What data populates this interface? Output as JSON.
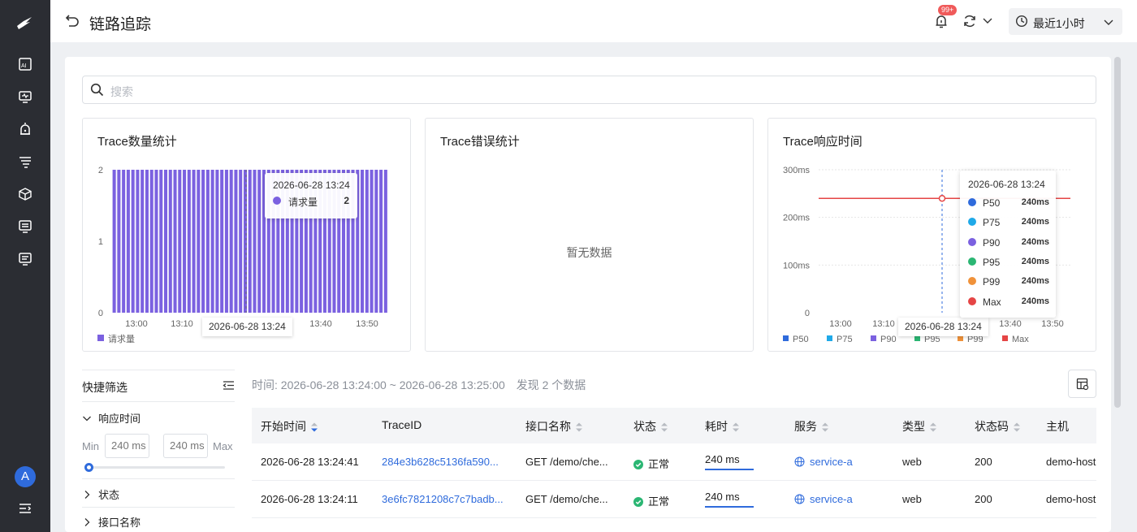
{
  "page": {
    "title": "链路追踪"
  },
  "header": {
    "badge": "99+",
    "time_range": "最近1小时"
  },
  "search": {
    "placeholder": "搜索"
  },
  "cards": {
    "count": {
      "title": "Trace数量统计",
      "legend": "请求量",
      "tooltip_time": "2026-06-28 13:24",
      "tooltip_label": "请求量",
      "tooltip_value": "2",
      "xtip": "2026-06-28 13:24"
    },
    "errors": {
      "title": "Trace错误统计",
      "empty": "暂无数据"
    },
    "latency": {
      "title": "Trace响应时间",
      "tooltip_time": "2026-06-28 13:24",
      "xtip": "2026-06-28 13:24",
      "tooltip_rows": [
        {
          "name": "P50",
          "value": "240ms",
          "color": "#2f6bdc"
        },
        {
          "name": "P75",
          "value": "240ms",
          "color": "#1fa9e8"
        },
        {
          "name": "P90",
          "value": "240ms",
          "color": "#7b61e0"
        },
        {
          "name": "P95",
          "value": "240ms",
          "color": "#2bb673"
        },
        {
          "name": "P99",
          "value": "240ms",
          "color": "#f0923a"
        },
        {
          "name": "Max",
          "value": "240ms",
          "color": "#e54545"
        }
      ]
    }
  },
  "chart_data": [
    {
      "type": "bar",
      "title": "Trace数量统计",
      "ylim": [
        0,
        2
      ],
      "yticks": [
        "0",
        "1",
        "2"
      ],
      "xticks": [
        "13:00",
        "13:10",
        "13:20",
        "13:30",
        "13:40",
        "13:50"
      ],
      "series": [
        {
          "name": "请求量",
          "color": "#7b61e0",
          "values": [
            2,
            2,
            2,
            2,
            2,
            2,
            2,
            2,
            2,
            2,
            2,
            2,
            2,
            2,
            2,
            2,
            2,
            2,
            2,
            2,
            2,
            2,
            2,
            2,
            2,
            2,
            2,
            2,
            2,
            2,
            2,
            2,
            2,
            2,
            2,
            2,
            2,
            2,
            2,
            2,
            2,
            2,
            2,
            2,
            2,
            2,
            2,
            2,
            2,
            2,
            2,
            2,
            2,
            2,
            2,
            2,
            2,
            2,
            2
          ]
        }
      ]
    },
    {
      "type": "line",
      "title": "Trace响应时间",
      "ylim": [
        0,
        300
      ],
      "yticks": [
        "0",
        "100ms",
        "200ms",
        "300ms"
      ],
      "xticks": [
        "13:00",
        "13:10",
        "13:20",
        "13:30",
        "13:40",
        "13:50"
      ],
      "legend": [
        {
          "name": "P50",
          "color": "#2f6bdc"
        },
        {
          "name": "P75",
          "color": "#1fa9e8"
        },
        {
          "name": "P90",
          "color": "#7b61e0"
        },
        {
          "name": "P95",
          "color": "#2bb673"
        },
        {
          "name": "P99",
          "color": "#f0923a"
        },
        {
          "name": "Max",
          "color": "#e54545"
        }
      ],
      "series": [
        {
          "name": "Max",
          "color": "#e54545",
          "values": [
            240,
            240
          ]
        }
      ]
    }
  ],
  "quick_filter": {
    "title": "快捷筛选",
    "section_latency": "响应时间",
    "min_label": "Min",
    "max_label": "Max",
    "min_placeholder": "240 ms",
    "max_placeholder": "240 ms",
    "section_status": "状态",
    "section_more": "接口名称"
  },
  "table_info": {
    "time": "时间:  2026-06-28 13:24:00 ~ 2026-06-28 13:25:00",
    "found": "发现 2 个数据"
  },
  "table": {
    "columns": [
      "开始时间",
      "TraceID",
      "接口名称",
      "状态",
      "耗时",
      "服务",
      "类型",
      "状态码",
      "主机"
    ],
    "rows": [
      {
        "start": "2026-06-28 13:24:41",
        "trace": "284e3b628c5136fa590...",
        "api": "GET /demo/che...",
        "status": "正常",
        "duration": "240 ms",
        "service": "service-a",
        "type": "web",
        "code": "200",
        "host": "demo-host"
      },
      {
        "start": "2026-06-28 13:24:11",
        "trace": "3e6fc7821208c7c7badb...",
        "api": "GET /demo/che...",
        "status": "正常",
        "duration": "240 ms",
        "service": "service-a",
        "type": "web",
        "code": "200",
        "host": "demo-host"
      }
    ]
  },
  "sidebar": {
    "avatar": "A"
  }
}
